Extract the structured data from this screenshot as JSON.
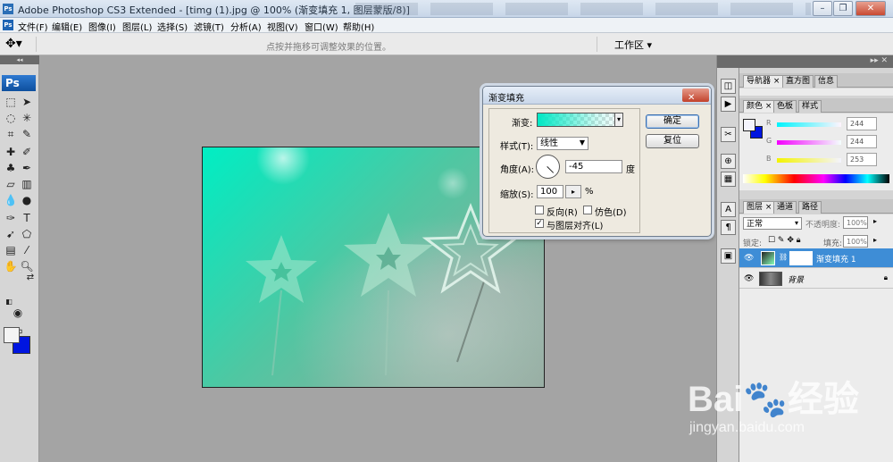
{
  "window": {
    "title": "Adobe Photoshop CS3 Extended - [timg (1).jpg @ 100% (渐变填充 1, 图层蒙版/8)]",
    "app_icon": "Ps",
    "controls": [
      "minimize-icon",
      "restore-icon",
      "close-icon"
    ]
  },
  "menubar": {
    "ps_icon": "Ps",
    "items": [
      "文件(F)",
      "编辑(E)",
      "图像(I)",
      "图层(L)",
      "选择(S)",
      "滤镜(T)",
      "分析(A)",
      "视图(V)",
      "窗口(W)",
      "帮助(H)"
    ]
  },
  "options_bar": {
    "tool_icon": "move-tool-icon",
    "hint": "点按并拖移可调整效果的位置。",
    "workspace_label": "工作区 ▾"
  },
  "toolbar": {
    "logo": "Ps",
    "foreground_color": "#f4f4f4",
    "background_color": "#0015e0"
  },
  "document": {
    "filename": "timg (1).jpg",
    "zoom": "100%",
    "gradient_colors": [
      "#00efc4",
      "#8fa89c"
    ]
  },
  "dialog": {
    "title": "渐变填充",
    "gradient_label": "渐变:",
    "style_label": "样式(T):",
    "style_value": "线性",
    "angle_label": "角度(A):",
    "angle_value": "-45",
    "angle_unit": "度",
    "scale_label": "缩放(S):",
    "scale_value": "100",
    "scale_unit": "%",
    "reverse_label": "反向(R)",
    "reverse_checked": false,
    "dither_label": "仿色(D)",
    "dither_checked": false,
    "align_label": "与图层对齐(L)",
    "align_checked": true,
    "ok_label": "确定",
    "reset_label": "复位"
  },
  "panels": {
    "nav_tabs": [
      "导航器 ×",
      "直方图",
      "信息"
    ],
    "color_tabs": [
      "颜色 ×",
      "色板",
      "样式"
    ],
    "color": {
      "channels": [
        {
          "name": "R",
          "value": "244"
        },
        {
          "name": "G",
          "value": "244"
        },
        {
          "name": "B",
          "value": "253"
        }
      ]
    },
    "layers_tabs": [
      "图层 ×",
      "通道",
      "路径"
    ],
    "blend_mode": "正常",
    "opacity_label": "不透明度:",
    "opacity_value": "100%",
    "lock_label": "锁定:",
    "fill_label": "填充:",
    "fill_value": "100%",
    "layers": [
      {
        "name": "渐变填充 1",
        "selected": true
      },
      {
        "name": "背景",
        "selected": false
      }
    ]
  },
  "watermark": {
    "brand": "Bai🐾经验",
    "url": "jingyan.baidu.com"
  }
}
